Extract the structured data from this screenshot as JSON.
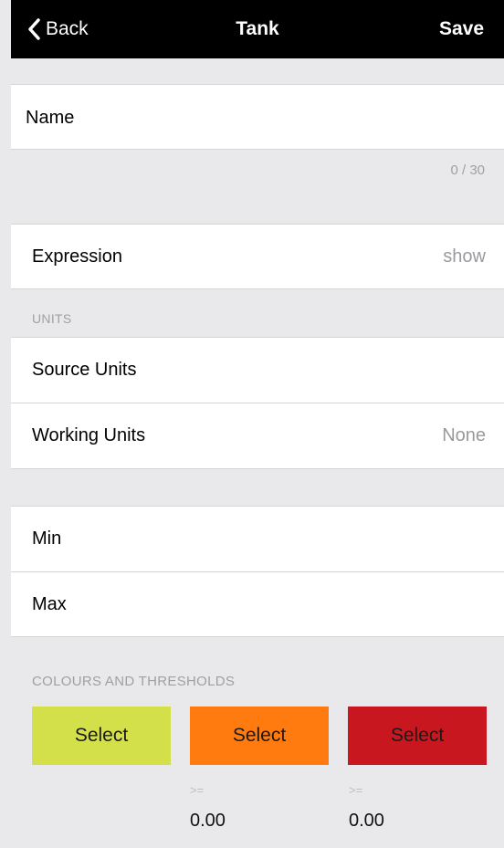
{
  "nav": {
    "back_label": "Back",
    "title": "Tank",
    "save_label": "Save"
  },
  "name_row": {
    "label": "Name"
  },
  "name_counter": "0 / 30",
  "expression_row": {
    "label": "Expression",
    "value": "show"
  },
  "units_section": {
    "header": "UNITS"
  },
  "source_units_row": {
    "label": "Source Units"
  },
  "working_units_row": {
    "label": "Working Units",
    "value": "None"
  },
  "min_row": {
    "label": "Min"
  },
  "max_row": {
    "label": "Max"
  },
  "colours_section": {
    "header": "COLOURS AND THRESHOLDS",
    "buttons": [
      {
        "label": "Select",
        "color": "#d4e04a"
      },
      {
        "label": "Select",
        "color": "#ff7b0f"
      },
      {
        "label": "Select",
        "color": "#c8171e"
      }
    ],
    "thresholds": [
      {
        "operator": ">=",
        "value": "0.00"
      },
      {
        "operator": ">=",
        "value": "0.00"
      }
    ]
  }
}
